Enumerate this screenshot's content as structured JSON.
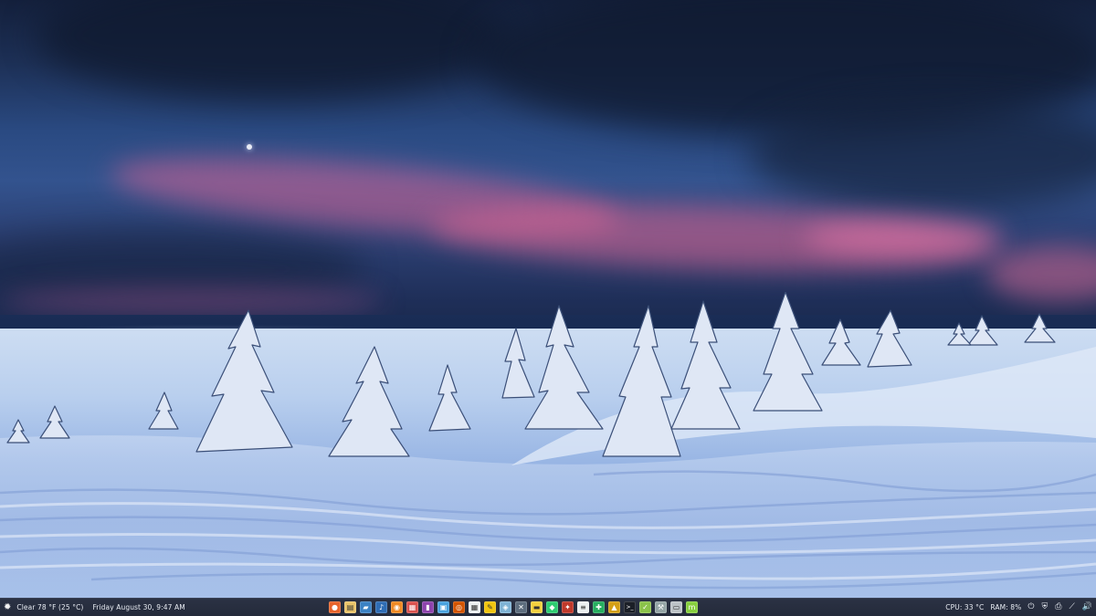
{
  "wallpaper": {
    "description_icon": "snowy-mountain-wallpaper"
  },
  "taskbar": {
    "weather": {
      "icon": "sun-icon",
      "text": "Clear 78 °F (25 °C)"
    },
    "clock": {
      "text": "Friday August 30, 9:47 AM"
    },
    "launchers": [
      {
        "name": "firefox-launcher",
        "icon": "firefox-icon",
        "color": "#e8642b"
      },
      {
        "name": "notes-launcher",
        "icon": "notes-icon",
        "color": "#e9c46a"
      },
      {
        "name": "files-launcher",
        "icon": "folder-icon",
        "color": "#3b82c4"
      },
      {
        "name": "music-launcher",
        "icon": "music-icon",
        "color": "#2f6db5"
      },
      {
        "name": "rss-launcher",
        "icon": "rss-icon",
        "color": "#f08a24"
      },
      {
        "name": "photos-launcher",
        "icon": "photos-icon",
        "color": "#d9534f"
      },
      {
        "name": "video-launcher",
        "icon": "video-icon",
        "color": "#8e44ad"
      },
      {
        "name": "image-viewer-launcher",
        "icon": "image-icon",
        "color": "#4aa3df"
      },
      {
        "name": "eye-launcher",
        "icon": "eye-icon",
        "color": "#d35400"
      },
      {
        "name": "calculator-launcher",
        "icon": "calculator-icon",
        "color": "#ecf0f1"
      },
      {
        "name": "editor-launcher",
        "icon": "pencil-icon",
        "color": "#f1c40f"
      },
      {
        "name": "maps-launcher",
        "icon": "map-icon",
        "color": "#7fb3d5"
      },
      {
        "name": "network-launcher",
        "icon": "network-icon",
        "color": "#5d6d7e"
      },
      {
        "name": "sticky-launcher",
        "icon": "sticky-note-icon",
        "color": "#f4d03f"
      },
      {
        "name": "game-launcher",
        "icon": "game-icon",
        "color": "#2ecc71"
      },
      {
        "name": "paint-launcher",
        "icon": "paint-icon",
        "color": "#c0392b"
      },
      {
        "name": "writer-launcher",
        "icon": "document-icon",
        "color": "#ecf0f1"
      },
      {
        "name": "tools-launcher",
        "icon": "tools-icon",
        "color": "#27ae60"
      },
      {
        "name": "archive-launcher",
        "icon": "archive-icon",
        "color": "#d4a017"
      },
      {
        "name": "terminal-launcher",
        "icon": "terminal-icon",
        "color": "#1b1f27"
      },
      {
        "name": "tasks-launcher",
        "icon": "checkmark-icon",
        "color": "#8bc34a"
      },
      {
        "name": "settings-launcher",
        "icon": "wrench-icon",
        "color": "#95a5a6"
      },
      {
        "name": "disk-launcher",
        "icon": "disk-icon",
        "color": "#bdc3c7"
      },
      {
        "name": "mint-launcher",
        "icon": "mint-icon",
        "color": "#87cf3e"
      }
    ],
    "cpu": {
      "text": "CPU: 33 °C"
    },
    "ram": {
      "text": "RAM: 8%"
    },
    "tray": [
      {
        "name": "power-icon",
        "glyph": "⏻"
      },
      {
        "name": "shield-icon",
        "glyph": "⛨"
      },
      {
        "name": "printer-icon",
        "glyph": "⎙"
      },
      {
        "name": "network-tray-icon",
        "glyph": "⟋"
      },
      {
        "name": "volume-icon",
        "glyph": "🔊"
      }
    ]
  }
}
